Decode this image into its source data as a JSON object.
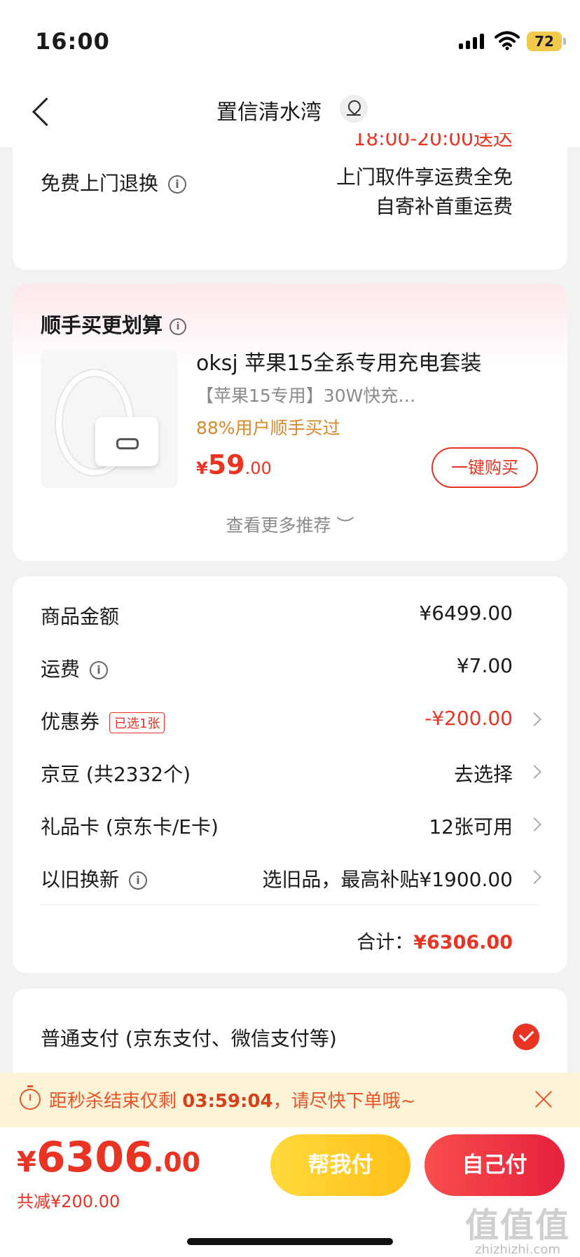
{
  "status_bar": {
    "time": "16:00",
    "battery": "72"
  },
  "nav": {
    "title": "置信清水湾"
  },
  "delivery": {
    "clipped_time": "18:00-20:00送达",
    "return_label": "免费上门退换",
    "return_line1": "上门取件享运费全免",
    "return_line2": "自寄补首重运费"
  },
  "recommend": {
    "title": "顺手买更划算",
    "product_name": "oksj 苹果15全系专用充电套装",
    "product_desc": "【苹果15专用】30W快充…",
    "bought_hint": "88%用户顺手买过",
    "price_currency": "¥",
    "price_int": "59",
    "price_dec": ".00",
    "buy_button": "一键购买",
    "more": "查看更多推荐 ︶"
  },
  "costs": {
    "goods_label": "商品金额",
    "goods_value": "¥6499.00",
    "shipping_label": "运费",
    "shipping_value": "¥7.00",
    "coupon_label": "优惠券",
    "coupon_tag": "已选1张",
    "coupon_value": "-¥200.00",
    "jd_bean_label": "京豆 (共2332个)",
    "jd_bean_value": "去选择",
    "gift_card_label": "礼品卡 (京东卡/E卡)",
    "gift_card_value": "12张可用",
    "trade_in_label": "以旧换新",
    "trade_in_value": "选旧品，最高补贴¥1900.00",
    "total_label": "合计：",
    "total_value": "¥6306.00"
  },
  "payment": {
    "label": "普通支付 (京东支付、微信支付等)"
  },
  "flash": {
    "prefix": "距秒杀结束仅剩 ",
    "countdown": "03:59:04",
    "suffix": "，请尽快下单哦~"
  },
  "bottom": {
    "currency": "¥",
    "price_int": "6306",
    "price_dec": ".00",
    "saved": "共减¥200.00",
    "help_pay": "帮我付",
    "self_pay": "自己付"
  },
  "watermark": {
    "big": "值值值",
    "small": "zhizhizhi.com"
  },
  "colors": {
    "accent_red": "#e93323",
    "flash_orange": "#e8552a",
    "help_yellow": "#ffc01a",
    "bought_orange": "#d6892b"
  }
}
